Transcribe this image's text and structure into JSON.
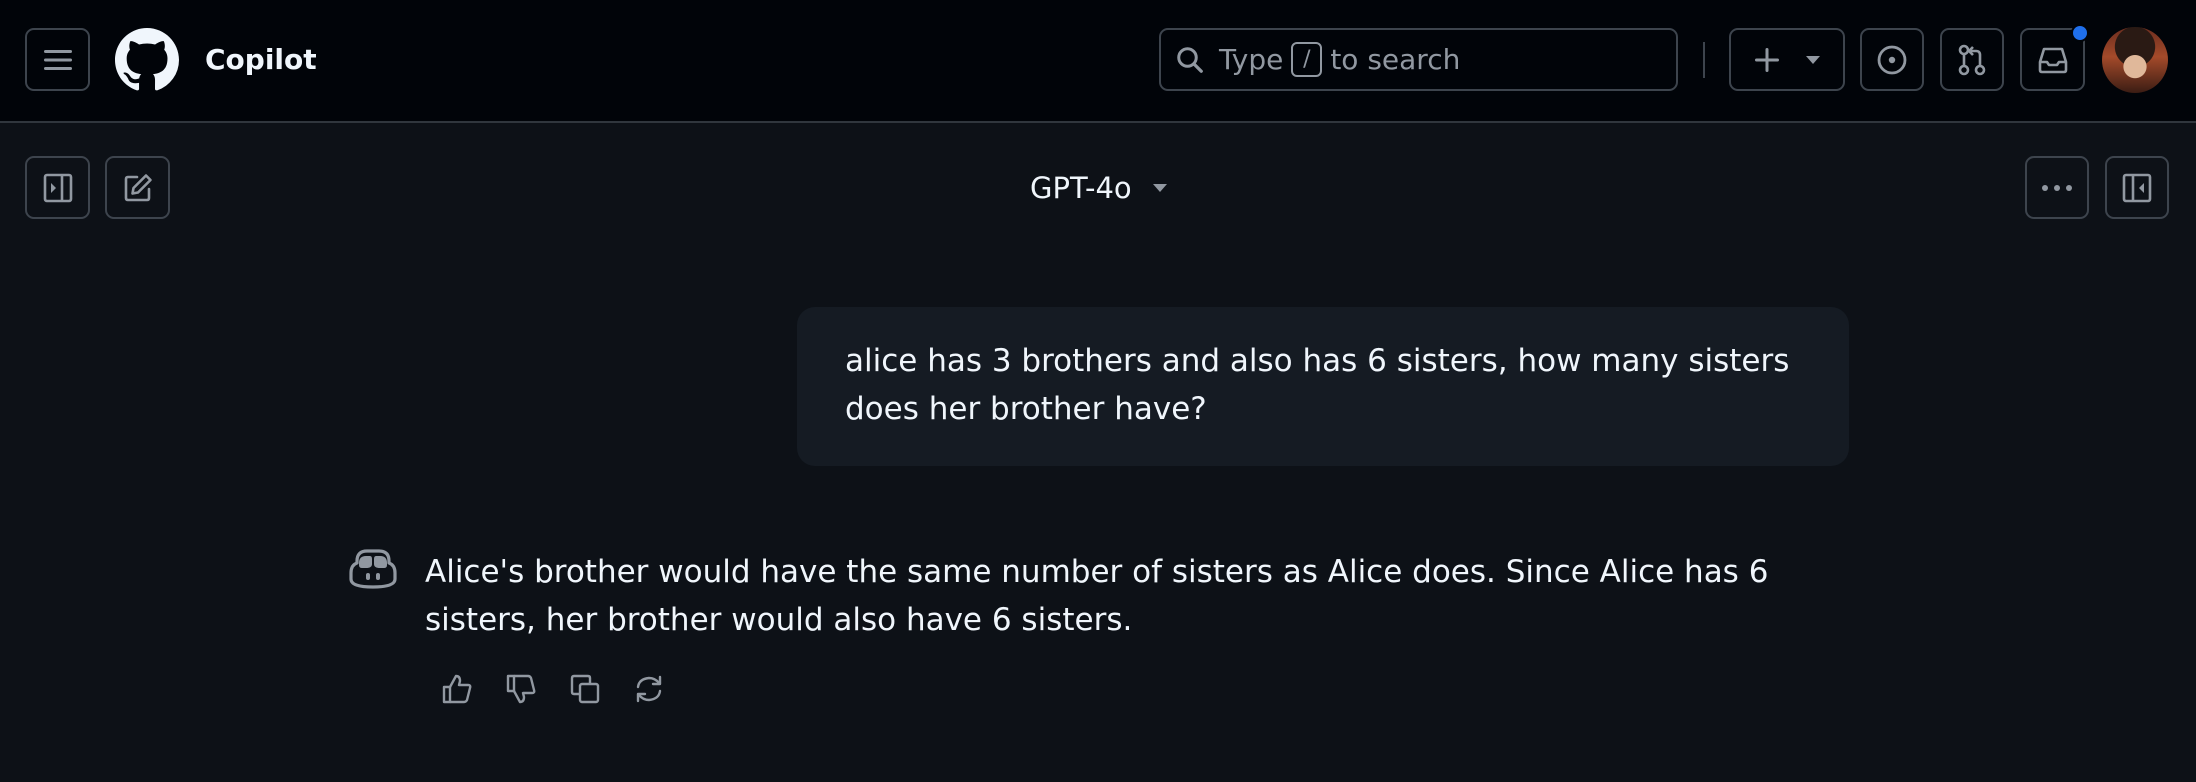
{
  "header": {
    "app_title": "Copilot",
    "search": {
      "prefix": "Type",
      "shortcut": "/",
      "suffix": "to search"
    },
    "notification_color": "#1f6feb"
  },
  "toolbar": {
    "model_name": "GPT-4o"
  },
  "conversation": {
    "user_message": "alice has 3 brothers and also has 6 sisters, how many sisters does her brother have?",
    "assistant_message": "Alice's brother would have the same number of sisters as Alice does. Since Alice has 6 sisters, her brother would also have 6 sisters."
  },
  "icons": {
    "menu": "hamburger-icon",
    "logo": "github-logo",
    "search": "search-icon",
    "plus": "plus-icon",
    "issues": "issue-opened-icon",
    "pull_requests": "git-pull-request-icon",
    "inbox": "inbox-icon",
    "sidebar": "sidebar-expand-icon",
    "new_chat": "pencil-square-icon",
    "more": "kebab-horizontal-icon",
    "panel": "sidebar-collapse-icon",
    "copilot": "copilot-icon",
    "thumbs_up": "thumbs-up-icon",
    "thumbs_down": "thumbs-down-icon",
    "copy": "copy-icon",
    "regenerate": "sync-icon"
  }
}
